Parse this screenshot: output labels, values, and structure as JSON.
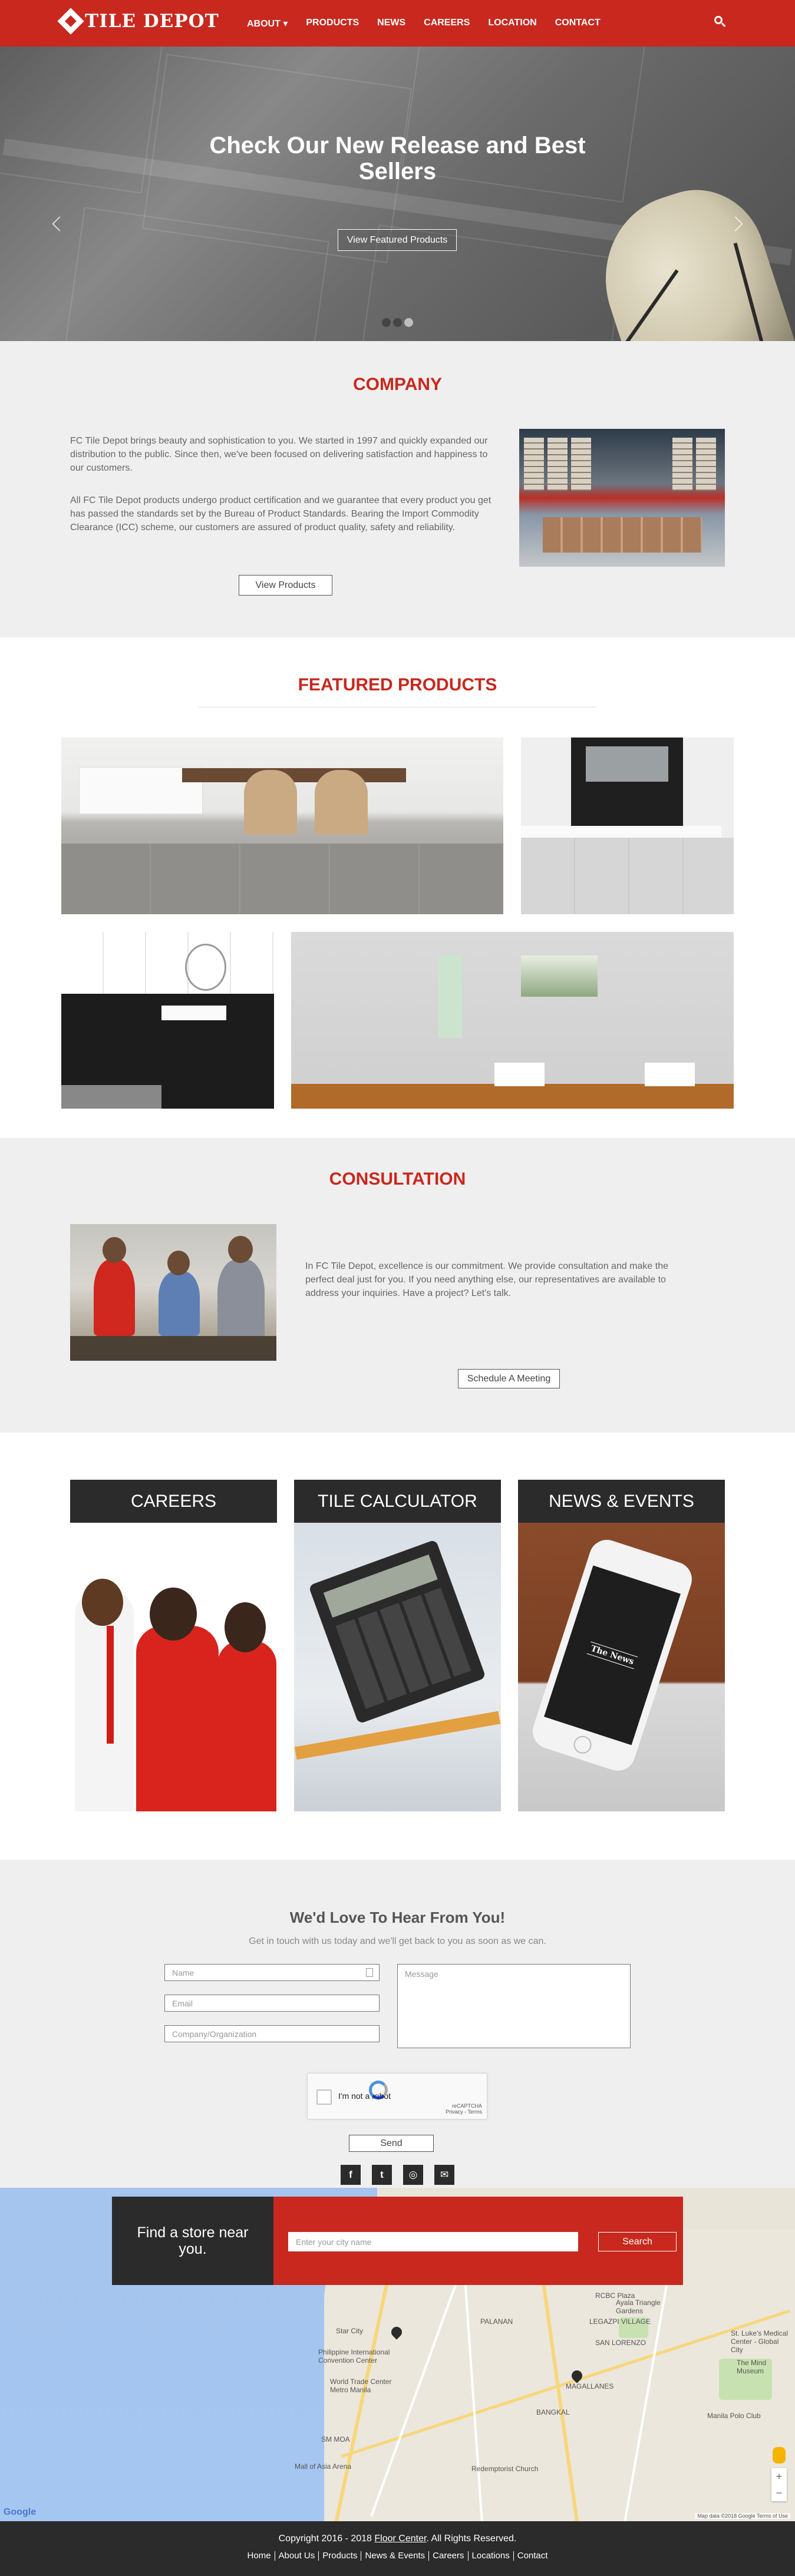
{
  "brand": {
    "name": "TILE DEPOT"
  },
  "nav": {
    "items": [
      {
        "label": "ABOUT ▾"
      },
      {
        "label": "PRODUCTS"
      },
      {
        "label": "NEWS"
      },
      {
        "label": "CAREERS"
      },
      {
        "label": "LOCATION"
      },
      {
        "label": "CONTACT"
      }
    ],
    "search_icon": "search-icon"
  },
  "hero": {
    "title_line1": "Check Our New Release and Best",
    "title_line2": "Sellers",
    "button": "View Featured Products",
    "slide_count": 3,
    "active_slide": 3
  },
  "company": {
    "title": "COMPANY",
    "para1": "FC Tile Depot brings beauty and sophistication to you. We started in 1997 and quickly expanded our distribution to the public. Since then, we've been focused on delivering satisfaction and happiness to our customers.",
    "para2": "All FC Tile Depot products undergo product certification and we guarantee that every product you get has passed the standards set by the Bureau of Product Standards. Bearing the Import Commodity Clearance (ICC) scheme, our customers are assured of product quality, safety and reliability.",
    "button": "View Products"
  },
  "featured": {
    "title": "FEATURED PRODUCTS"
  },
  "consultation": {
    "title": "CONSULTATION",
    "text": "In FC Tile Depot, excellence is our commitment. We provide consultation and make the perfect deal just for you. If you need anything else, our representatives are available to address your inquiries. Have a project? Let's talk.",
    "button": "Schedule A Meeting"
  },
  "cards": [
    {
      "title": "CAREERS"
    },
    {
      "title": "TILE CALCULATOR"
    },
    {
      "title": "NEWS & EVENTS",
      "phone_text": "The News"
    }
  ],
  "contact": {
    "heading": "We'd Love To Hear From You!",
    "subheading": "Get in touch with us today and we'll get back to you as soon as we can.",
    "name_placeholder": "Name",
    "email_placeholder": "Email",
    "company_placeholder": "Company/Organization",
    "message_placeholder": "Message",
    "captcha_label": "I'm not a robot",
    "captcha_brand": "reCAPTCHA",
    "captcha_terms": "Privacy - Terms",
    "send_button": "Send",
    "socials": [
      {
        "icon": "facebook-icon",
        "glyph": "f"
      },
      {
        "icon": "twitter-icon",
        "glyph": "t"
      },
      {
        "icon": "instagram-icon",
        "glyph": "◎"
      },
      {
        "icon": "email-icon",
        "glyph": "✉"
      }
    ]
  },
  "store_finder": {
    "heading": "Find a store near you.",
    "input_placeholder": "Enter your city name",
    "button": "Search"
  },
  "map": {
    "labels": [
      "PALANAN",
      "Star City",
      "Philippine International Convention Center",
      "World Trade Center Metro Manila",
      "SM MOA",
      "Mall of Asia Arena",
      "RCBC Plaza",
      "LEGAZPI VILLAGE",
      "Ayala Triangle Gardens",
      "SAN LORENZO",
      "BANGKAL",
      "MAGALLANES",
      "St. Luke's Medical Center - Global City",
      "The Mind Museum",
      "Manila Polo Club",
      "Redemptorist Church"
    ],
    "google_label": "Google",
    "terms": "Map data ©2018 Google   Terms of Use"
  },
  "footer": {
    "copyright_pre": "Copyright 2016 - 2018 ",
    "copyright_link": "Floor Center",
    "copyright_post": ". All Rights Reserved.",
    "links": [
      "Home",
      "About Us",
      "Products",
      "News & Events",
      "Careers",
      "Locations",
      "Contact"
    ]
  }
}
